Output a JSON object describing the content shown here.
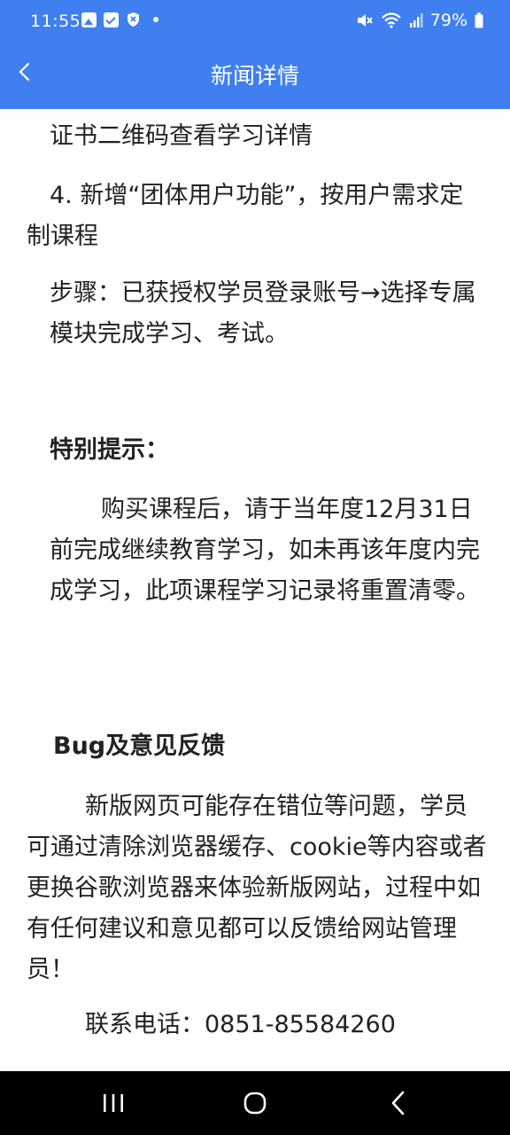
{
  "status_bar": {
    "time": "11:55",
    "battery": "79%",
    "icons": [
      "image-icon",
      "check-icon",
      "shield-icon",
      "dot-icon",
      "mute-icon",
      "wifi-icon",
      "signal-icon",
      "battery-icon"
    ]
  },
  "app_bar": {
    "title": "新闻详情",
    "back_icon": "chevron-left-icon"
  },
  "article": {
    "p1": "证书二维码查看学习详情",
    "p2": "4. 新增“团体用户功能”，按用户需求定制课程",
    "p3": "步骤：已获授权学员登录账号→选择专属模块完成学习、考试。",
    "tip_heading": "特别提示：",
    "tip_body": "购买课程后，请于当年度12月31日前完成继续教育学习，如未再该年度内完成学习，此项课程学习记录将重置清零。",
    "bug_heading": "Bug及意见反馈",
    "bug_body": "新版网页可能存在错位等问题，学员可通过清除浏览器缓存、cookie等内容或者更换谷歌浏览器来体验新版网站，过程中如有任何建议和意见都可以反馈给网站管理员！",
    "contact": "联系电话：0851-85584260"
  },
  "nav_bar": {
    "icons": [
      "recent-apps-icon",
      "home-icon",
      "back-icon"
    ]
  },
  "colors": {
    "primary": "#3f7ff0",
    "text": "#222222",
    "nav_background": "#000000"
  }
}
